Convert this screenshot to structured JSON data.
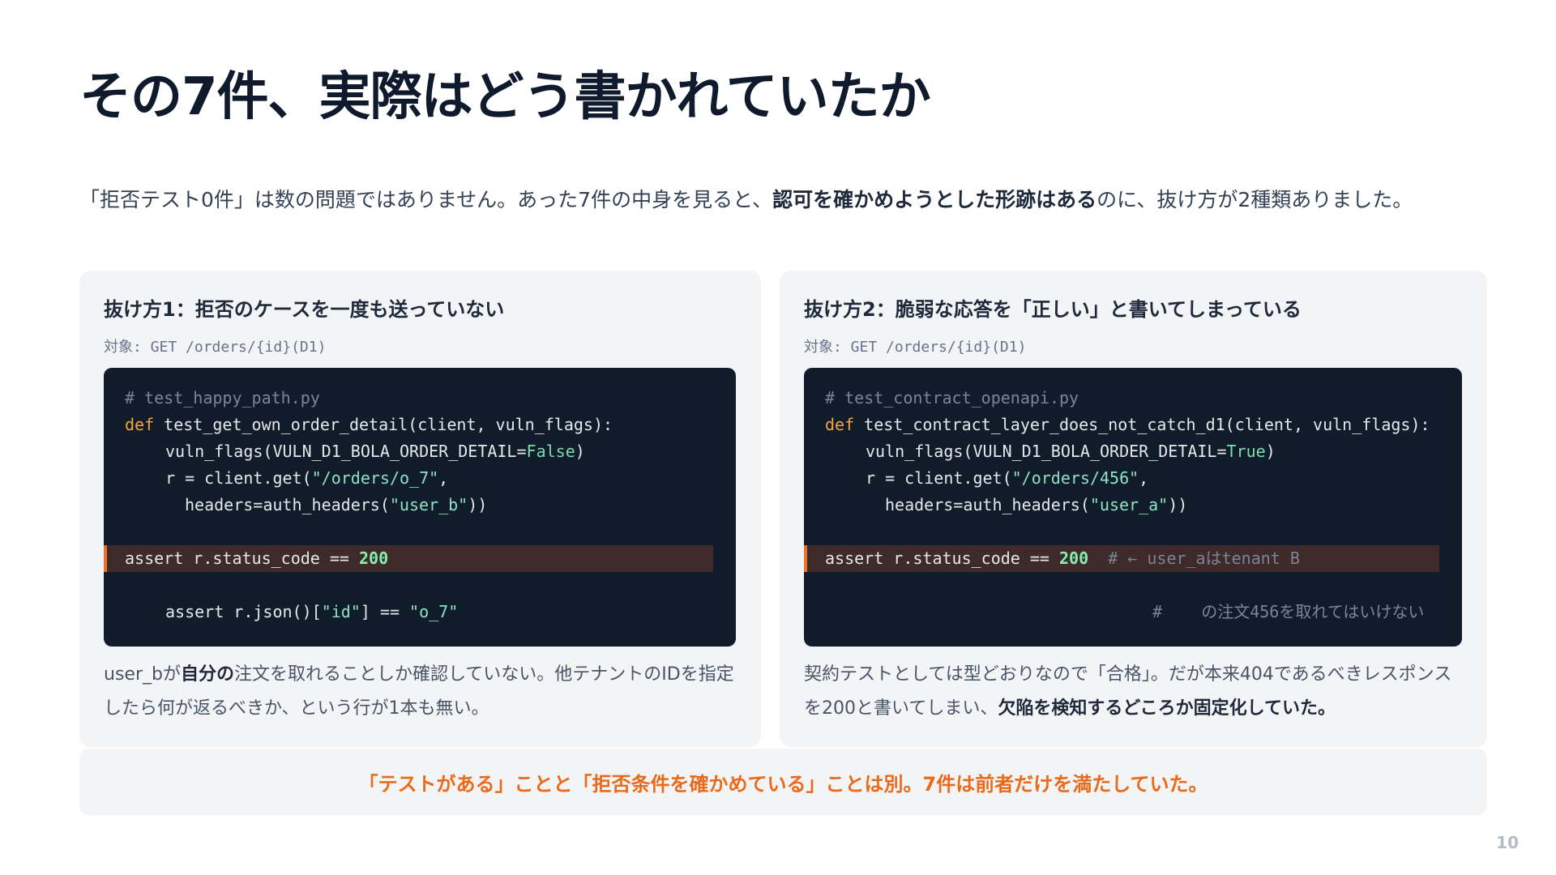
{
  "title": "その7件、実際はどう書かれていたか",
  "intro": {
    "before": "「拒否テスト0件」は数の問題ではありません。あった7件の中身を見ると、",
    "bold": "認可を確かめようとした形跡はある",
    "after": "のに、抜け方が2種類ありました。"
  },
  "panels": [
    {
      "heading": "抜け方1：拒否のケースを一度も送っていない",
      "target": "対象: GET /orders/{id}(D1)",
      "code": {
        "l1": "# test_happy_path.py",
        "l2_kw": "def",
        "l2_rest": " test_get_own_order_detail(client, vuln_flags):",
        "l3_a": "vuln_flags(VULN_D1_BOLA_ORDER_DETAIL=",
        "l3_b": "False",
        "l3_c": ")",
        "l4_a": "r = client.get(",
        "l4_b": "\"/orders/o_7\"",
        "l4_c": ",",
        "l5_a": "headers=auth_headers(",
        "l5_b": "\"user_b\"",
        "l5_c": "))",
        "l6_a": "assert r.status_code == ",
        "l6_b": "200",
        "l7_a": "assert r.json()[",
        "l7_b": "\"id\"",
        "l7_c": "] == ",
        "l7_d": "\"o_7\""
      },
      "desc": {
        "a": "user_bが",
        "b": "自分の",
        "c": "注文を取れることしか確認していない。他テナントのIDを指定したら何が返るべきか、という行が1本も無い。"
      }
    },
    {
      "heading": "抜け方2：脆弱な応答を「正しい」と書いてしまっている",
      "target": "対象: GET /orders/{id}(D1)",
      "code": {
        "l1": "# test_contract_openapi.py",
        "l2_kw": "def",
        "l2_rest": " test_contract_layer_does_not_catch_d1(client, vuln_flags):",
        "l3_a": "vuln_flags(VULN_D1_BOLA_ORDER_DETAIL=",
        "l3_b": "True",
        "l3_c": ")",
        "l4_a": "r = client.get(",
        "l4_b": "\"/orders/456\"",
        "l4_c": ",",
        "l5_a": "headers=auth_headers(",
        "l5_b": "\"user_a\"",
        "l5_c": "))",
        "l6_a": "assert r.status_code == ",
        "l6_b": "200",
        "l6_comment": "  # ← user_aはtenant B",
        "l7_comment": "#    の注文456を取れてはいけない"
      },
      "desc": {
        "a": "契約テストとしては型どおりなので「合格」。だが本来404であるべきレスポンスを200と書いてしまい、",
        "b": "欠陥を検知するどころか固定化していた。"
      }
    }
  ],
  "banner": "「テストがある」ことと「拒否条件を確かめている」ことは別。7件は前者だけを満たしていた。",
  "page_number": "10"
}
